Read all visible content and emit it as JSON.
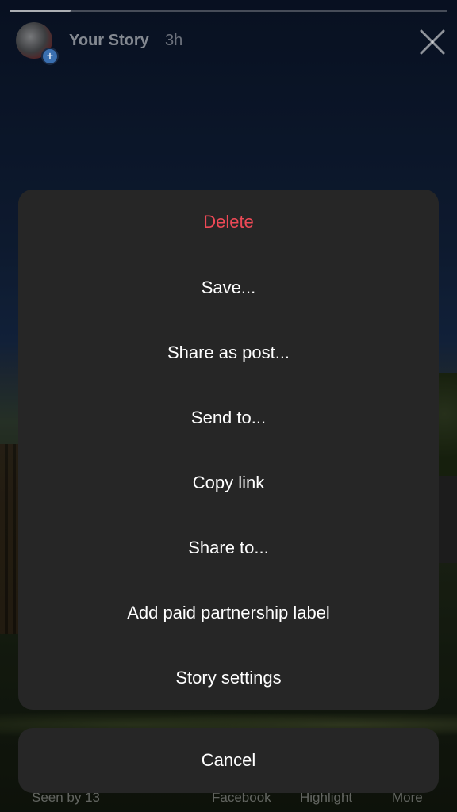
{
  "story": {
    "title": "Your Story",
    "time": "3h",
    "progress_fraction": 0.14
  },
  "bottom_bar": {
    "seen": "Seen by 13",
    "facebook": "Facebook",
    "highlight": "Highlight",
    "more": "More"
  },
  "sheet": {
    "items": [
      {
        "label": "Delete"
      },
      {
        "label": "Save..."
      },
      {
        "label": "Share as post..."
      },
      {
        "label": "Send to..."
      },
      {
        "label": "Copy link"
      },
      {
        "label": "Share to..."
      },
      {
        "label": "Add paid partnership label"
      },
      {
        "label": "Story settings"
      }
    ],
    "cancel_label": "Cancel"
  },
  "colors": {
    "destructive": "#ed4956",
    "sheet_background": "#262626"
  },
  "icons": {
    "close": "close-icon",
    "add": "plus-icon"
  }
}
